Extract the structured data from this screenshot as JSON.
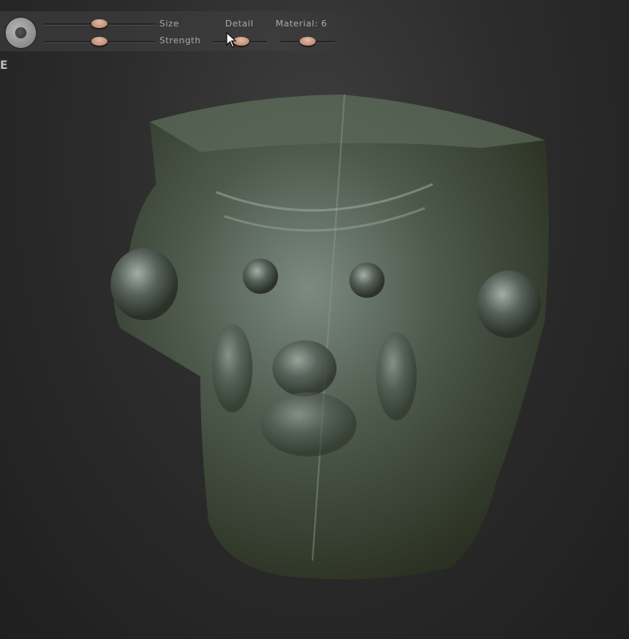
{
  "toolbar": {
    "brush_icon": "brush-ring-icon",
    "size": {
      "label": "Size",
      "value": 0.5
    },
    "strength": {
      "label": "Strength",
      "value": 0.5
    },
    "detail": {
      "label": "Detail",
      "value": 0.53
    },
    "material": {
      "label": "Material: 6",
      "value": 0.5
    }
  },
  "edge_label": "E",
  "colors": {
    "model": "#4a5446",
    "handle": "#d9a78f",
    "background": "#2c2c2c"
  }
}
